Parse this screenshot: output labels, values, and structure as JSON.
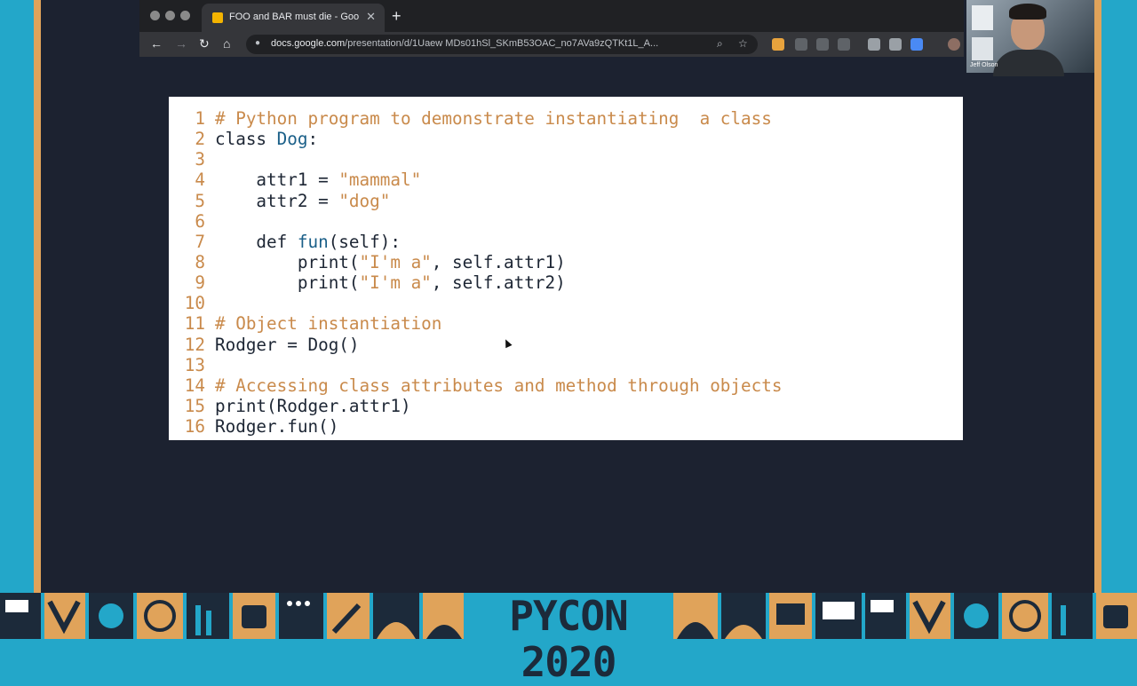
{
  "browser": {
    "tab_title": "FOO and BAR must die - Goo",
    "tab_close": "✕",
    "new_tab": "+",
    "url_host": "docs.google.com",
    "url_path": "/presentation/d/1Uaew MDs01hSl_SKmB53OAC_no7AVa9zQTKt1L_A...",
    "back": "←",
    "forward": "→",
    "reload": "↻",
    "home": "⌂",
    "lock": "🔒",
    "search": "⌕",
    "star": "☆"
  },
  "webcam": {
    "participant_name": "Jeff Olson"
  },
  "slide": {
    "lines": [
      {
        "num": "1",
        "parts": [
          {
            "t": "# Python program to demonstrate instantiating  a class",
            "c": "cm"
          }
        ]
      },
      {
        "num": "2",
        "parts": [
          {
            "t": "class ",
            "c": "kw"
          },
          {
            "t": "Dog",
            "c": "fn"
          },
          {
            "t": ":",
            "c": "kw"
          }
        ]
      },
      {
        "num": "3",
        "parts": []
      },
      {
        "num": "4",
        "parts": [
          {
            "t": "    attr1 = ",
            "c": "kw"
          },
          {
            "t": "\"mammal\"",
            "c": "st"
          }
        ]
      },
      {
        "num": "5",
        "parts": [
          {
            "t": "    attr2 = ",
            "c": "kw"
          },
          {
            "t": "\"dog\"",
            "c": "st"
          }
        ]
      },
      {
        "num": "6",
        "parts": []
      },
      {
        "num": "7",
        "parts": [
          {
            "t": "    def ",
            "c": "kw"
          },
          {
            "t": "fun",
            "c": "fn"
          },
          {
            "t": "(self):",
            "c": "kw"
          }
        ]
      },
      {
        "num": "8",
        "parts": [
          {
            "t": "        print(",
            "c": "kw"
          },
          {
            "t": "\"I'm a\"",
            "c": "st"
          },
          {
            "t": ", self.attr1)",
            "c": "kw"
          }
        ]
      },
      {
        "num": "9",
        "parts": [
          {
            "t": "        print(",
            "c": "kw"
          },
          {
            "t": "\"I'm a\"",
            "c": "st"
          },
          {
            "t": ", self.attr2)",
            "c": "kw"
          }
        ]
      },
      {
        "num": "10",
        "parts": []
      },
      {
        "num": "11",
        "parts": [
          {
            "t": "# Object instantiation",
            "c": "cm"
          }
        ]
      },
      {
        "num": "12",
        "parts": [
          {
            "t": "Rodger = Dog()",
            "c": "kw"
          }
        ]
      },
      {
        "num": "13",
        "parts": []
      },
      {
        "num": "14",
        "parts": [
          {
            "t": "# Accessing class attributes and method through objects",
            "c": "cm"
          }
        ]
      },
      {
        "num": "15",
        "parts": [
          {
            "t": "print(Rodger.attr1)",
            "c": "kw"
          }
        ]
      },
      {
        "num": "16",
        "parts": [
          {
            "t": "Rodger.fun()",
            "c": "kw"
          }
        ]
      }
    ]
  },
  "banner": {
    "text": "PYCON 2020"
  },
  "colors": {
    "accent_orange": "#e0a35a",
    "teal": "#23a7c9",
    "stage_bg": "#1c2230"
  }
}
